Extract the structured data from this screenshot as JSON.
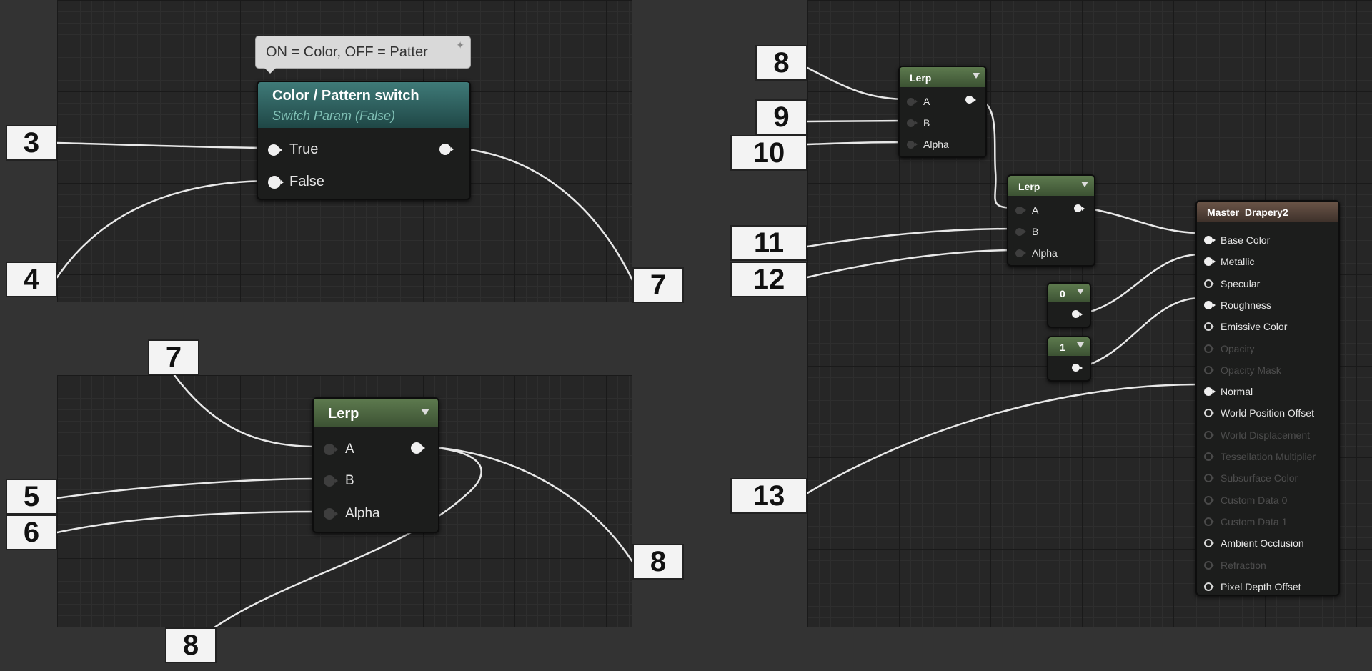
{
  "switch_node": {
    "comment": "ON = Color, OFF = Patter",
    "title": "Color / Pattern switch",
    "subtitle": "Switch Param (False)",
    "input_true": "True",
    "input_false": "False"
  },
  "lerp_bottom": {
    "title": "Lerp",
    "input_a": "A",
    "input_b": "B",
    "input_alpha": "Alpha"
  },
  "lerp_right_1": {
    "title": "Lerp",
    "input_a": "A",
    "input_b": "B",
    "input_alpha": "Alpha"
  },
  "lerp_right_2": {
    "title": "Lerp",
    "input_a": "A",
    "input_b": "B",
    "input_alpha": "Alpha"
  },
  "constant_0": {
    "value": "0"
  },
  "constant_1": {
    "value": "1"
  },
  "material_node": {
    "title": "Master_Drapery2",
    "pins": [
      {
        "label": "Base Color",
        "state": "connected"
      },
      {
        "label": "Metallic",
        "state": "connected"
      },
      {
        "label": "Specular",
        "state": "open"
      },
      {
        "label": "Roughness",
        "state": "connected"
      },
      {
        "label": "Emissive Color",
        "state": "open"
      },
      {
        "label": "Opacity",
        "state": "disabled"
      },
      {
        "label": "Opacity Mask",
        "state": "disabled"
      },
      {
        "label": "Normal",
        "state": "connected"
      },
      {
        "label": "World Position Offset",
        "state": "open"
      },
      {
        "label": "World Displacement",
        "state": "disabled"
      },
      {
        "label": "Tessellation Multiplier",
        "state": "disabled"
      },
      {
        "label": "Subsurface Color",
        "state": "disabled"
      },
      {
        "label": "Custom Data 0",
        "state": "disabled"
      },
      {
        "label": "Custom Data 1",
        "state": "disabled"
      },
      {
        "label": "Ambient Occlusion",
        "state": "open"
      },
      {
        "label": "Refraction",
        "state": "disabled"
      },
      {
        "label": "Pixel Depth Offset",
        "state": "open"
      }
    ]
  },
  "callouts": {
    "c3": "3",
    "c4": "4",
    "c7a": "7",
    "c7b": "7",
    "c5": "5",
    "c6": "6",
    "c8a": "8",
    "c8b": "8",
    "c8c": "8",
    "c9": "9",
    "c10": "10",
    "c11": "11",
    "c12": "12",
    "c13": "13"
  },
  "colors": {
    "canvas": "#262626",
    "background": "#333333",
    "lerp_header": "#5d7a4e",
    "switch_header": "#3f7a78",
    "material_header": "#6b5548"
  }
}
